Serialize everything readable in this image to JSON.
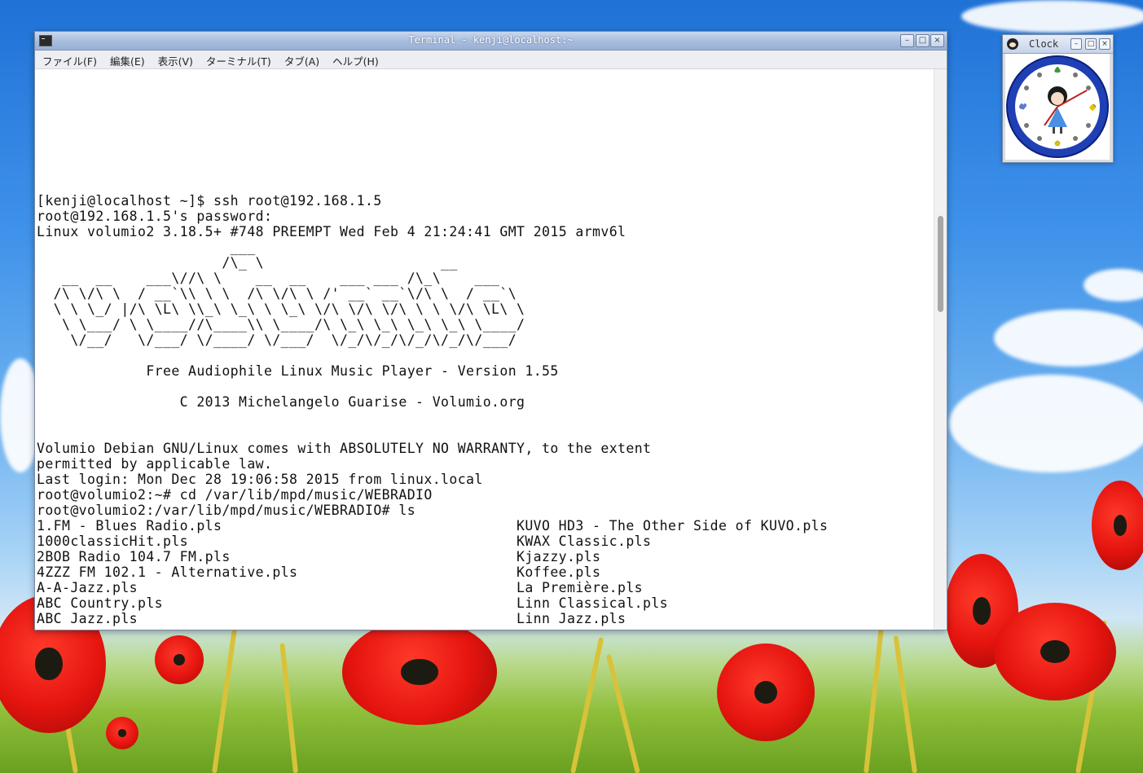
{
  "desktop": {
    "sky": "#2a7fe0",
    "accent_poppy": "#e5140f"
  },
  "terminal": {
    "title": "Terminal - kenji@localhost:~",
    "menu": [
      "ファイル(F)",
      "編集(E)",
      "表示(V)",
      "ターミナル(T)",
      "タブ(A)",
      "ヘルプ(H)"
    ],
    "lines": [
      "[kenji@localhost ~]$ ssh root@192.168.1.5",
      "root@192.168.1.5's password:",
      "Linux volumio2 3.18.5+ #748 PREEMPT Wed Feb 4 21:24:41 GMT 2015 armv6l",
      "                       ___",
      "                      /\\_ \\                     __",
      "   __  __    ___\\//\\ \\    __  __    ___ ___ /\\_\\    ___",
      "  /\\ \\/\\ \\  / __`\\\\ \\ \\  /\\ \\/\\ \\ /' __` __`\\/\\ \\  / __`\\",
      "  \\ \\ \\_/ |/\\ \\L\\ \\\\_\\ \\_\\ \\ \\_\\ \\/\\ \\/\\ \\/\\ \\ \\ \\/\\ \\L\\ \\",
      "   \\ \\___/ \\ \\____//\\____\\\\ \\____/\\ \\_\\ \\_\\ \\_\\ \\_\\ \\____/",
      "    \\/__/   \\/___/ \\/____/ \\/___/  \\/_/\\/_/\\/_/\\/_/\\/___/",
      "             Free Audiophile Linux Music Player - Version 1.55",
      "                 C 2013 Michelangelo Guarise - Volumio.org",
      "Volumio Debian GNU/Linux comes with ABSOLUTELY NO WARRANTY, to the extent",
      "permitted by applicable law.",
      "Last login: Mon Dec 28 19:06:58 2015 from linux.local",
      "root@volumio2:~# cd /var/lib/mpd/music/WEBRADIO",
      "root@volumio2:/var/lib/mpd/music/WEBRADIO# ls"
    ],
    "files_left": [
      "1.FM - Blues Radio.pls",
      "1000classicHit.pls",
      "2BOB Radio 104.7 FM.pls",
      "4ZZZ FM 102.1 - Alternative.pls",
      "A-A-Jazz.pls",
      "ABC Country.pls",
      "ABC Jazz.pls"
    ],
    "files_right": [
      "KUVO HD3 - The Other Side of KUVO.pls",
      "KWAX Classic.pls",
      "Kjazzy.pls",
      "Koffee.pls",
      "La Première.pls",
      "Linn Classical.pls",
      "Linn Jazz.pls"
    ]
  },
  "clock": {
    "title": "Clock"
  }
}
